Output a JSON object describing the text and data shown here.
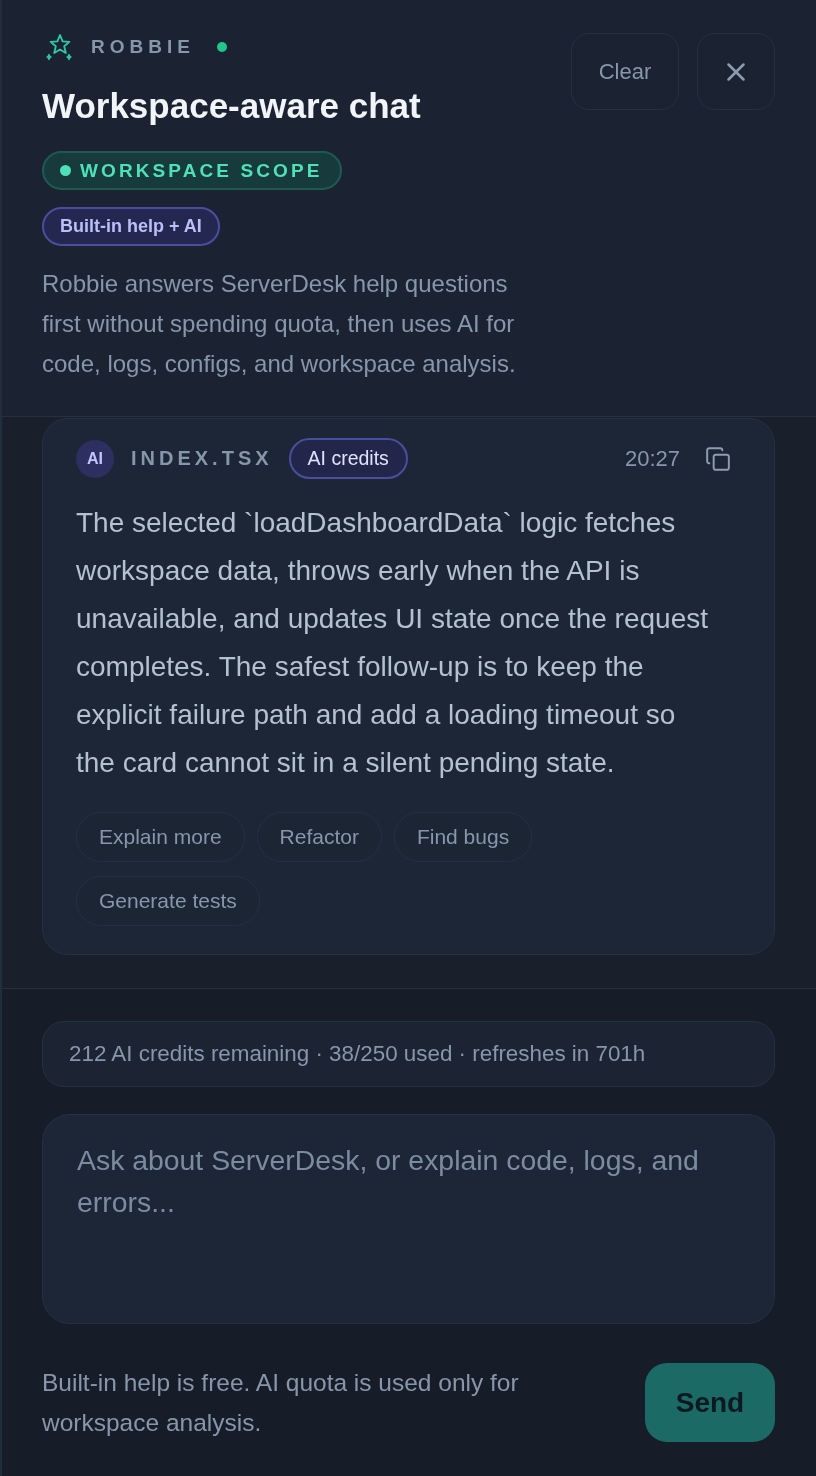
{
  "header": {
    "assistant_name": "ROBBIE",
    "online": true,
    "title": "Workspace-aware chat",
    "scope_badge": "WORKSPACE SCOPE",
    "mode_badge": "Built-in help + AI",
    "description": "Robbie answers ServerDesk help questions first without spending quota, then uses AI for code, logs, configs, and workspace analysis.",
    "clear_button": "Clear"
  },
  "messages": [
    {
      "avatar": "AI",
      "file": "INDEX.TSX",
      "badge": "AI credits",
      "time": "20:27",
      "text": "The selected `loadDashboardData` logic fetches workspace data, throws early when the API is unavailable, and updates UI state once the request completes. The safest follow-up is to keep the explicit failure path and add a loading timeout so the card cannot sit in a silent pending state.",
      "suggestions": [
        "Explain more",
        "Refactor",
        "Find bugs",
        "Generate tests"
      ]
    }
  ],
  "quota": {
    "text": "212 AI credits remaining · 38/250 used · refreshes in 701h"
  },
  "composer": {
    "placeholder": "Ask about ServerDesk, or explain code, logs, and errors...",
    "note": "Built-in help is free. AI quota is used only for workspace analysis.",
    "send_button": "Send"
  }
}
